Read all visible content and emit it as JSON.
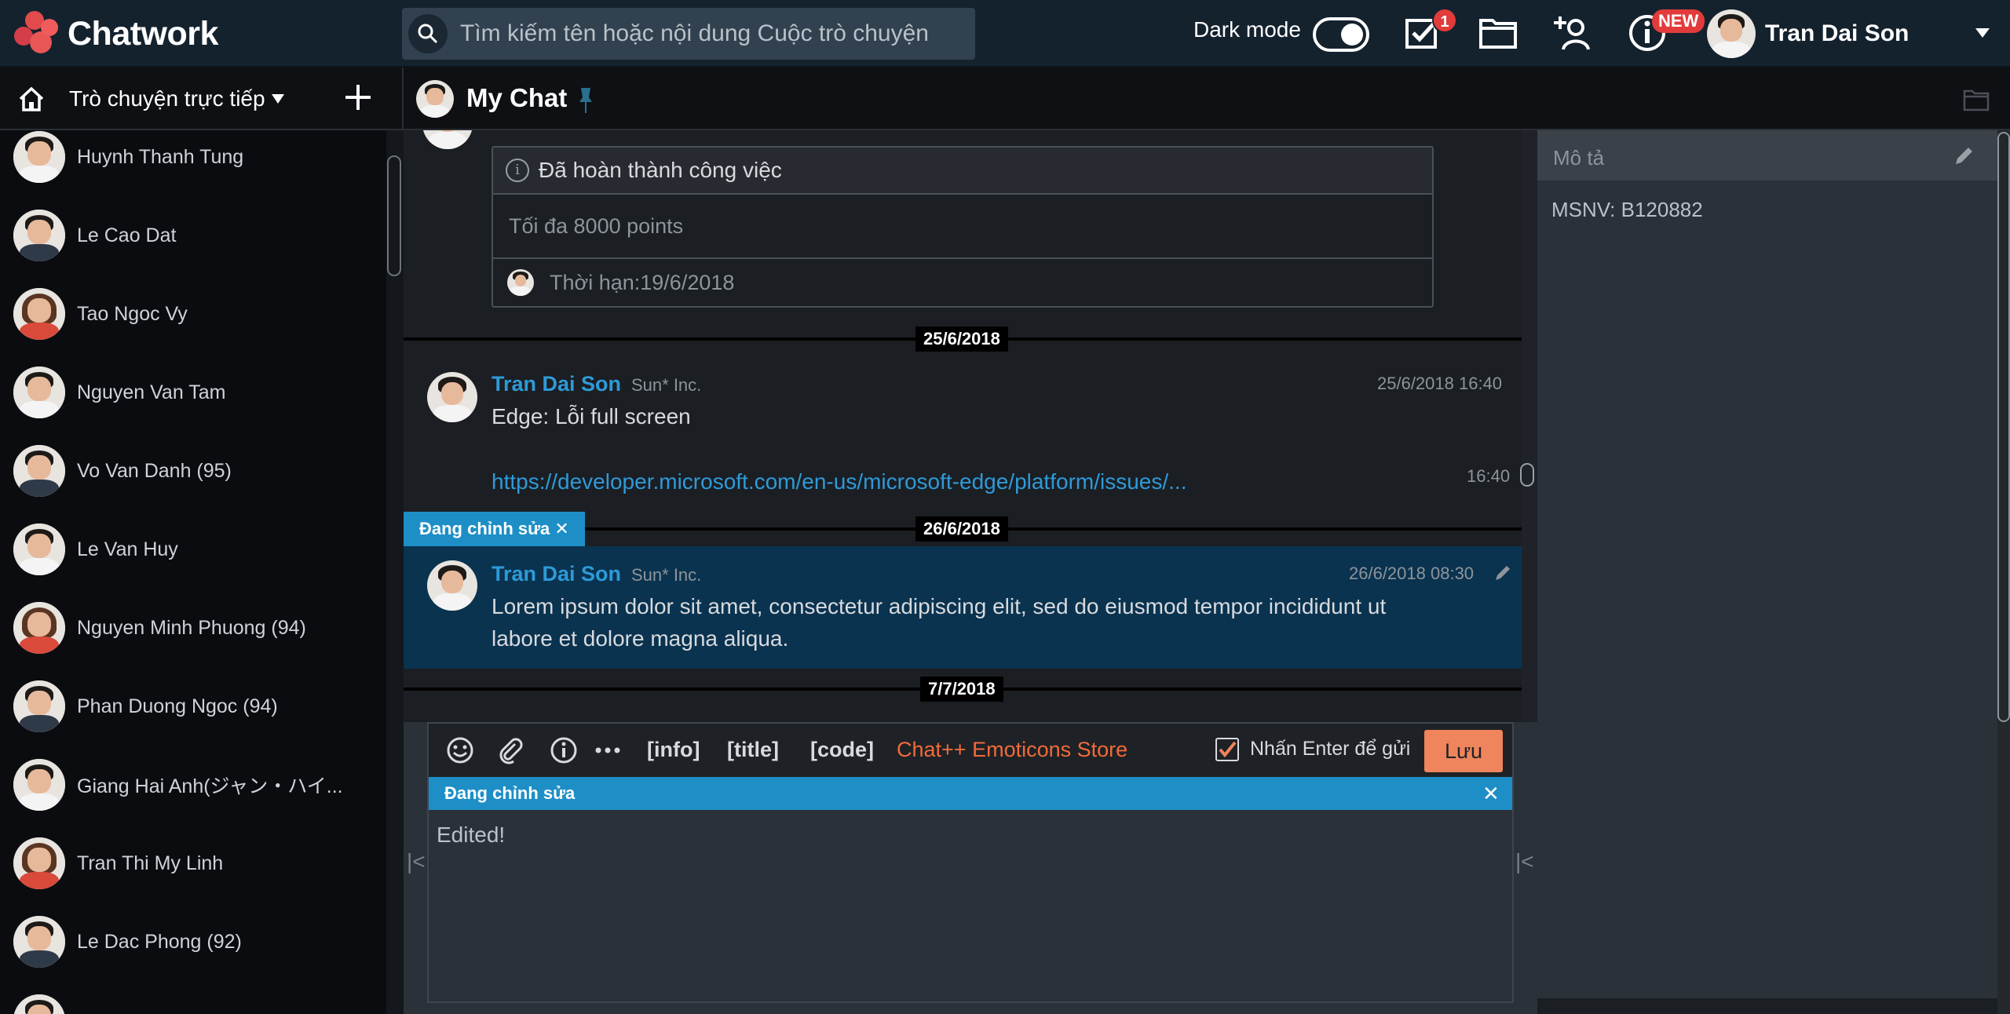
{
  "app": {
    "name": "Chatwork"
  },
  "header": {
    "search_placeholder": "Tìm kiếm tên hoặc nội dung Cuộc trò chuyện",
    "dark_mode_label": "Dark mode",
    "dark_mode_on": true,
    "task_badge": "1",
    "new_badge": "NEW",
    "user_name": "Tran Dai Son"
  },
  "subbar": {
    "room_filter": "Trò chuyện trực tiếp",
    "chat_title": "My Chat"
  },
  "contacts": [
    {
      "name": "Huynh Thanh Tung",
      "female": false
    },
    {
      "name": "Le Cao Dat",
      "female": false
    },
    {
      "name": "Tao Ngoc Vy",
      "female": true
    },
    {
      "name": "Nguyen Van Tam",
      "female": false
    },
    {
      "name": "Vo Van Danh (95)",
      "female": false
    },
    {
      "name": "Le Van Huy",
      "female": false
    },
    {
      "name": "Nguyen Minh Phuong (94)",
      "female": true
    },
    {
      "name": "Phan Duong Ngoc (94)",
      "female": false
    },
    {
      "name": "Giang Hai Anh(ジャン・ハイ...",
      "female": false
    },
    {
      "name": "Tran Thi My Linh",
      "female": true
    },
    {
      "name": "Le Dac Phong (92)",
      "female": false
    }
  ],
  "task": {
    "status": "Đã hoàn thành công việc",
    "body": "Tối đa 8000 points",
    "deadline": "Thời hạn:19/6/2018"
  },
  "dates": [
    "25/6/2018",
    "26/6/2018",
    "7/7/2018"
  ],
  "messages": [
    {
      "name": "Tran Dai Son",
      "org": "Sun* Inc.",
      "time": "25/6/2018 16:40",
      "text": "Edge: Lỗi full screen",
      "link": "https://developer.microsoft.com/en-us/microsoft-edge/platform/issues/...",
      "link_time": "16:40"
    },
    {
      "name": "Tran Dai Son",
      "org": "Sun* Inc.",
      "time": "26/6/2018 08:30",
      "text_line1": "Lorem ipsum dolor sit amet, consectetur adipiscing elit, sed do eiusmod tempor incididunt ut",
      "text_line2": "labore et dolore magna aliqua."
    }
  ],
  "editing": {
    "tag": "Đang chỉnh sửa ✕",
    "bar_label": "Đang chỉnh sửa",
    "close": "✕"
  },
  "composer": {
    "tags": [
      "[info]",
      "[title]",
      "[code]"
    ],
    "store_link": "Chat++ Emoticons Store",
    "enter_label": "Nhấn Enter để gửi",
    "enter_checked": true,
    "save_label": "Lưu",
    "text": "Edited!"
  },
  "right_panel": {
    "title": "Mô tả",
    "description": "MSNV: B120882"
  }
}
